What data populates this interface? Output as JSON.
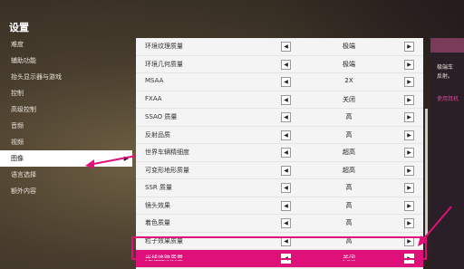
{
  "title": "设置",
  "sidebar": {
    "items": [
      {
        "label": "难度"
      },
      {
        "label": "辅助功能"
      },
      {
        "label": "抬头显示器与游戏"
      },
      {
        "label": "控制"
      },
      {
        "label": "高级控制"
      },
      {
        "label": "音频"
      },
      {
        "label": "视频"
      },
      {
        "label": "图像"
      },
      {
        "label": "语言选择"
      },
      {
        "label": "额外内容"
      }
    ],
    "active_caret": "▶"
  },
  "settings": {
    "rows": [
      {
        "label": "环境纹理质量",
        "value": "极端",
        "arrow_left": "◀",
        "arrow_right": "▶"
      },
      {
        "label": "环境几何质量",
        "value": "极端",
        "arrow_left": "◀",
        "arrow_right": "▶"
      },
      {
        "label": "MSAA",
        "value": "2X",
        "arrow_left": "◀",
        "arrow_right": "▶"
      },
      {
        "label": "FXAA",
        "value": "关闭",
        "arrow_left": "◀",
        "arrow_right": "▶"
      },
      {
        "label": "SSAO 质量",
        "value": "高",
        "arrow_left": "◀",
        "arrow_right": "▶"
      },
      {
        "label": "反射品质",
        "value": "高",
        "arrow_left": "◀",
        "arrow_right": "▶"
      },
      {
        "label": "世界车辆精细度",
        "value": "超高",
        "arrow_left": "◀",
        "arrow_right": "▶"
      },
      {
        "label": "可变形地形质量",
        "value": "超高",
        "arrow_left": "◀",
        "arrow_right": "▶"
      },
      {
        "label": "SSR 质量",
        "value": "高",
        "arrow_left": "◀",
        "arrow_right": "▶"
      },
      {
        "label": "镜头效果",
        "value": "高",
        "arrow_left": "◀",
        "arrow_right": "▶"
      },
      {
        "label": "着色质量",
        "value": "高",
        "arrow_left": "◀",
        "arrow_right": "▶"
      },
      {
        "label": "粒子效果质量",
        "value": "高",
        "arrow_left": "◀",
        "arrow_right": "▶"
      },
      {
        "label": "光线追踪质量",
        "value": "关闭",
        "arrow_left": "◀",
        "arrow_right": "▶"
      }
    ]
  },
  "right_panel": {
    "line1": "极端车",
    "line2": "反射。",
    "link": "使用耳机"
  },
  "colors": {
    "highlight": "#e0107a",
    "panel": "#f4f4f4"
  }
}
